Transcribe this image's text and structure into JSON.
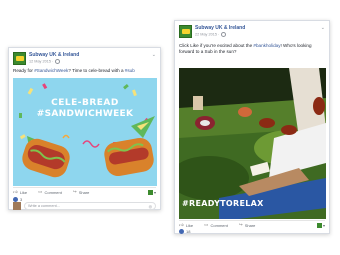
{
  "post1": {
    "page_name": "Subway UK & Ireland",
    "date": "12 May 2015 · ",
    "text_before": "Ready for ",
    "hashtag1": "#SandwichWeek",
    "text_mid": "? Time to cele-bread with a ",
    "hashtag2": "#sub",
    "image_text_line1": "CELE-BREAD",
    "image_text_line2": "#SANDWICHWEEK",
    "actions": {
      "like": "Like",
      "comment": "Comment",
      "share": "Share"
    },
    "likes_count": "3",
    "comment_placeholder": "Write a comment..."
  },
  "post2": {
    "page_name": "Subway UK & Ireland",
    "date": "22 May 2015 · ",
    "text_before": "Click Like if you're excited about the ",
    "hashtag1": "#bankholiday",
    "text_after": "! Who's looking forward to a Sub in the sun?",
    "image_text": "#READYTORELAX",
    "actions": {
      "like": "Like",
      "comment": "Comment",
      "share": "Share"
    },
    "likes_count": "18"
  },
  "icons": {
    "like": "thumbs-up-icon",
    "comment": "speech-bubble-icon",
    "share": "share-arrow-icon",
    "globe": "globe-icon",
    "menu": "chevron-down-icon"
  },
  "colors": {
    "fb_link": "#365899",
    "subway_green": "#3c8a2e",
    "subway_yellow": "#f6d32d",
    "like_blue": "#4267b2"
  }
}
